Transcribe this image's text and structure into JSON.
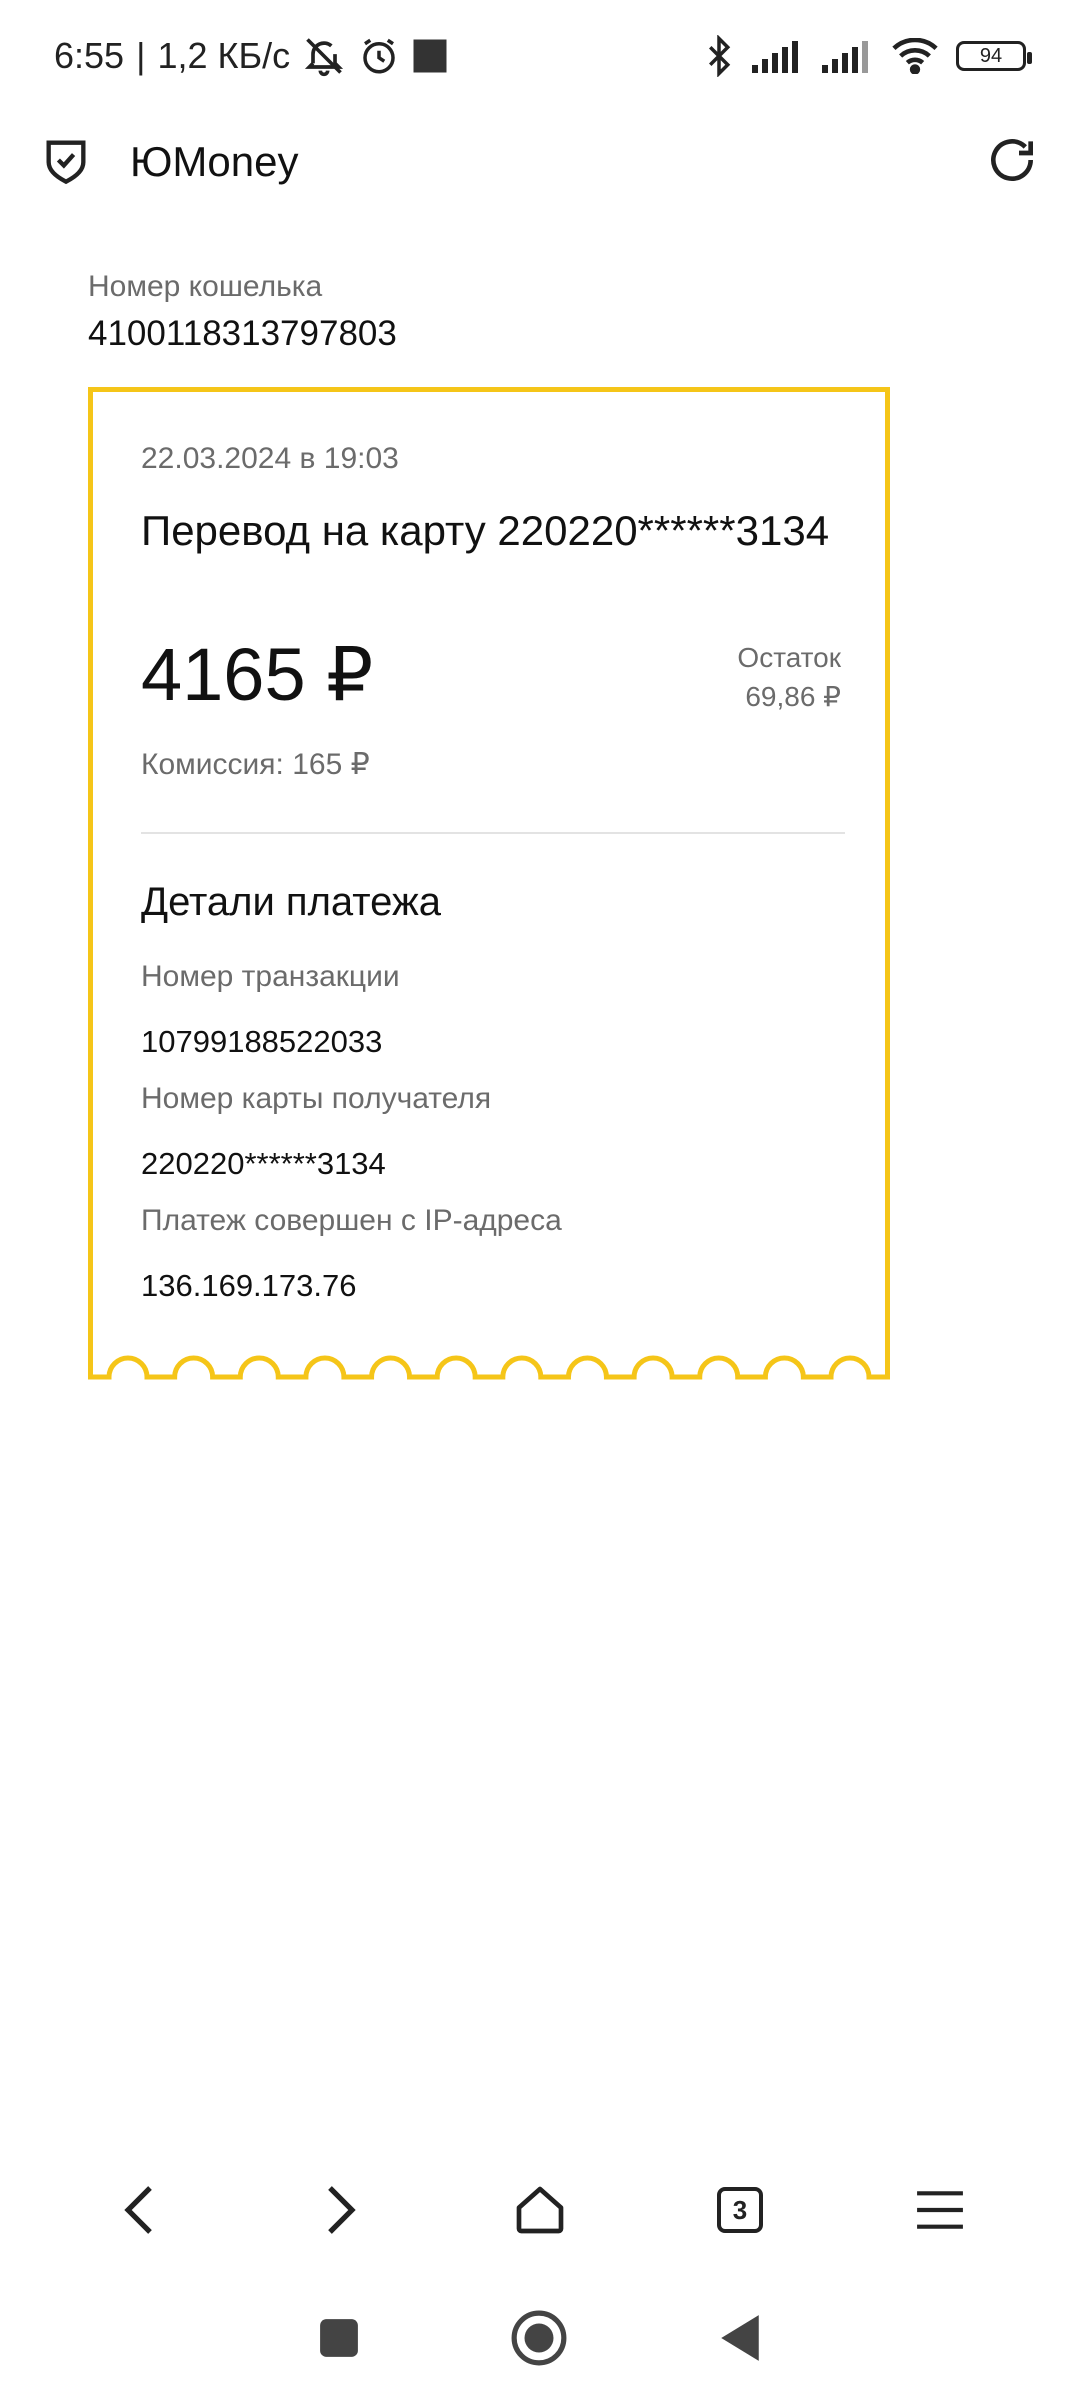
{
  "status_bar": {
    "time": "6:55",
    "network_speed": "1,2 КБ/с",
    "battery": "94"
  },
  "app": {
    "title": "ЮMoney"
  },
  "wallet": {
    "label": "Номер кошелька",
    "number": "4100118313797803"
  },
  "receipt": {
    "date": "22.03.2024 в 19:03",
    "title": "Перевод на карту 220220******3134",
    "amount": "4165 ₽",
    "balance_label": "Остаток",
    "balance_value": "69,86 ₽",
    "fee": "Комиссия: 165 ₽",
    "details_title": "Детали платежа",
    "details": [
      {
        "label": "Номер транзакции",
        "value": "10799188522033"
      },
      {
        "label": "Номер карты получателя",
        "value": "220220******3134"
      },
      {
        "label": "Платеж совершен с IP-адреса",
        "value": "136.169.173.76"
      }
    ]
  },
  "browser_nav": {
    "tabs_count": "3"
  },
  "colors": {
    "accent": "#f5c518",
    "muted_text": "#6b6b6b"
  }
}
